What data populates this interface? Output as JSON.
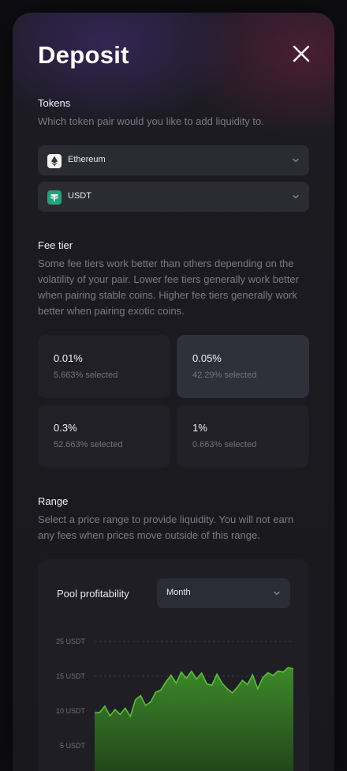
{
  "dialog": {
    "title": "Deposit"
  },
  "tokens": {
    "label": "Tokens",
    "description": "Which token pair would you like to add liquidity to.",
    "token_a": {
      "label": "Ethereum",
      "icon": "ethereum-icon"
    },
    "token_b": {
      "label": "USDT",
      "icon": "tether-icon"
    }
  },
  "fee_tier": {
    "label": "Fee tier",
    "description": "Some fee tiers work better than others depending on the volatility of your pair. Lower fee tiers generally work better when pairing stable coins. Higher fee tiers generally work better when pairing exotic coins.",
    "options": [
      {
        "pct": "0.01%",
        "selected_text": "5.663% selected",
        "selected": false
      },
      {
        "pct": "0.05%",
        "selected_text": "42.29% selected",
        "selected": true
      },
      {
        "pct": "0.3%",
        "selected_text": "52.663% selected",
        "selected": false
      },
      {
        "pct": "1%",
        "selected_text": "0.663% selected",
        "selected": false
      }
    ]
  },
  "range": {
    "label": "Range",
    "description": "Select a price range to provide liquidity. You will not earn any fees when prices move outside of this range."
  },
  "pool_profitability": {
    "title": "Pool profitability",
    "period": "Month"
  },
  "colors": {
    "accent_green": "#5bbf3a",
    "tether_green": "#26a17b"
  },
  "chart_data": {
    "type": "area",
    "title": "Pool profitability",
    "ytick_labels": [
      "25 USDT",
      "15 USDT",
      "10 USDT",
      "5 USDT"
    ],
    "yticks": [
      25,
      15,
      10,
      5
    ],
    "ylim": [
      0,
      25
    ],
    "grid": true,
    "values": [
      9.7,
      9.8,
      10.7,
      9.3,
      10.2,
      9.5,
      10.4,
      9.2,
      11.6,
      12.2,
      10.8,
      11.3,
      12.7,
      13.0,
      14.2,
      15.3,
      14.0,
      16.2,
      14.7,
      16.4,
      14.6,
      15.9,
      13.9,
      13.7,
      15.6,
      14.0,
      13.2,
      12.6,
      13.4,
      14.4,
      13.8,
      15.4,
      13.2,
      14.8,
      16.0,
      15.2,
      16.5,
      16.2,
      17.5,
      17.1
    ]
  }
}
